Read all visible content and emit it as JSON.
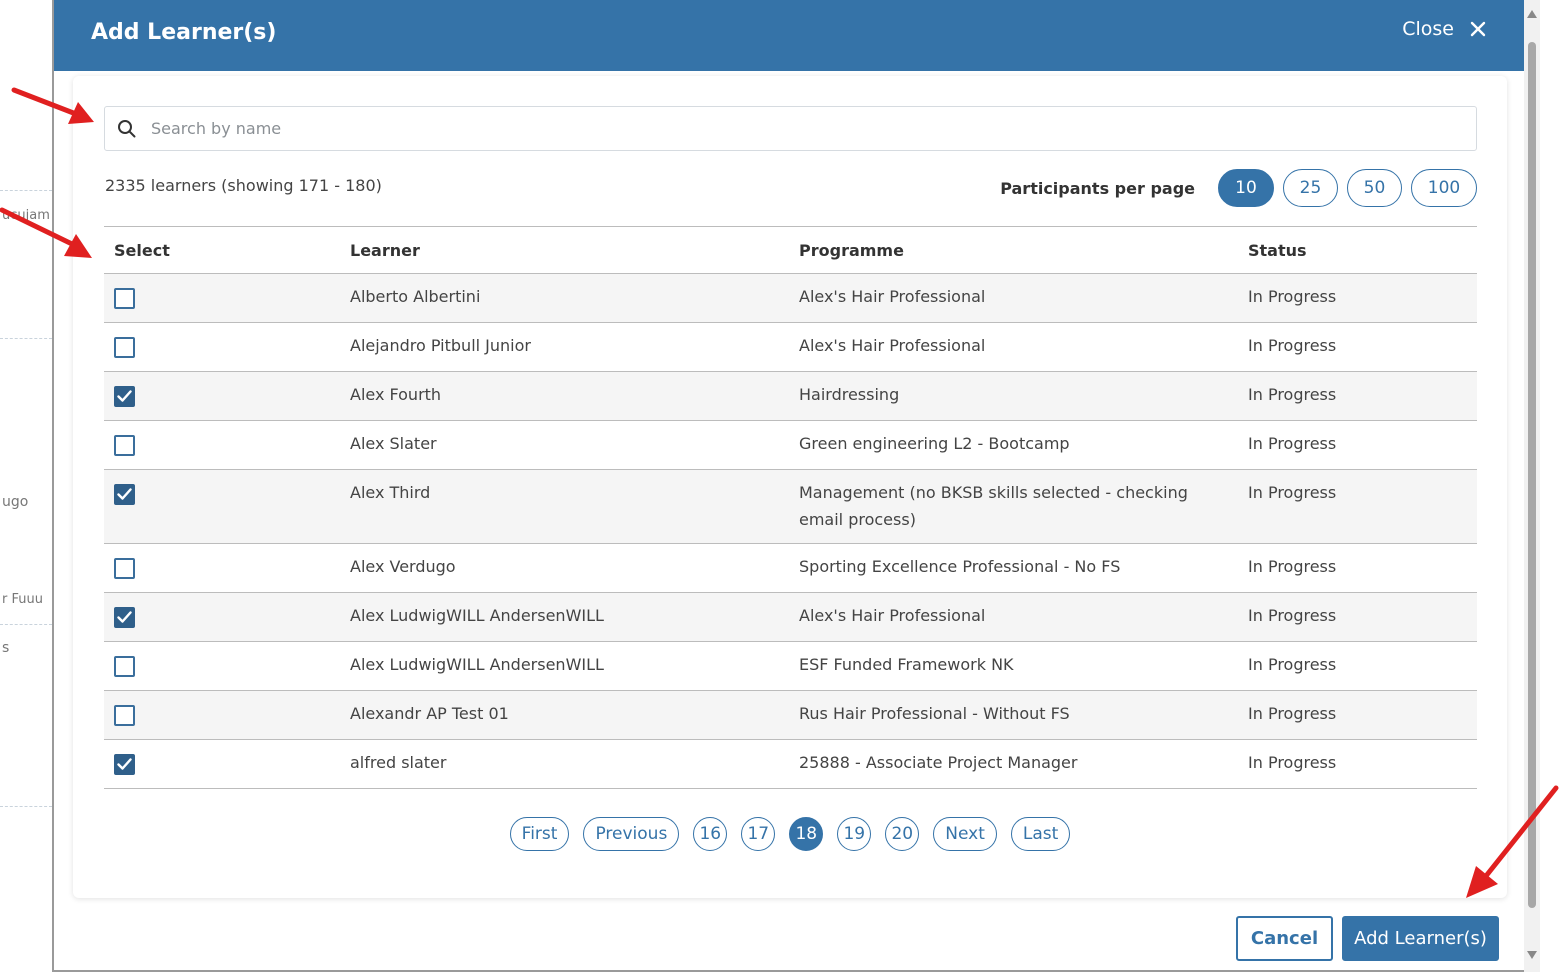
{
  "modal": {
    "title": "Add Learner(s)",
    "close_label": "Close"
  },
  "search": {
    "placeholder": "Search by name",
    "value": ""
  },
  "summary": {
    "count_text": "2335 learners (showing 171 - 180)"
  },
  "per_page": {
    "label": "Participants per page",
    "options": [
      "10",
      "25",
      "50",
      "100"
    ],
    "selected": "10"
  },
  "table": {
    "headers": {
      "select": "Select",
      "learner": "Learner",
      "programme": "Programme",
      "status": "Status"
    },
    "rows": [
      {
        "checked": false,
        "learner": "Alberto Albertini",
        "programme": "Alex's Hair Professional",
        "status": "In Progress"
      },
      {
        "checked": false,
        "learner": "Alejandro Pitbull Junior",
        "programme": "Alex's Hair Professional",
        "status": "In Progress"
      },
      {
        "checked": true,
        "learner": "Alex Fourth",
        "programme": "Hairdressing",
        "status": "In Progress"
      },
      {
        "checked": false,
        "learner": "Alex Slater",
        "programme": "Green engineering L2 - Bootcamp",
        "status": "In Progress"
      },
      {
        "checked": true,
        "learner": "Alex Third",
        "programme": "Management (no BKSB skills selected - checking email process)",
        "status": "In Progress"
      },
      {
        "checked": false,
        "learner": "Alex Verdugo",
        "programme": "Sporting Excellence Professional - No FS",
        "status": "In Progress"
      },
      {
        "checked": true,
        "learner": "Alex LudwigWILL AndersenWILL",
        "programme": "Alex's Hair Professional",
        "status": "In Progress"
      },
      {
        "checked": false,
        "learner": "Alex LudwigWILL AndersenWILL",
        "programme": "ESF Funded Framework NK",
        "status": "In Progress"
      },
      {
        "checked": false,
        "learner": "Alexandr AP Test 01",
        "programme": "Rus Hair Professional - Without FS",
        "status": "In Progress"
      },
      {
        "checked": true,
        "learner": "alfred slater",
        "programme": "25888 - Associate Project Manager",
        "status": "In Progress"
      }
    ]
  },
  "pagination": {
    "first": "First",
    "previous": "Previous",
    "pages": [
      "16",
      "17",
      "18",
      "19",
      "20"
    ],
    "current": "18",
    "next": "Next",
    "last": "Last"
  },
  "footer": {
    "cancel_label": "Cancel",
    "add_label": "Add Learner(s)"
  },
  "background_fragments": [
    "ucujam",
    "ugo",
    "r Fuuu",
    "s"
  ],
  "icons": {
    "search": "search-icon",
    "close": "close-icon",
    "checkbox_check": "check-icon"
  },
  "colors": {
    "primary": "#3573a8",
    "checkbox_checked": "#2f5f8a",
    "annotation_arrow": "#e02020",
    "row_stripe": "#f5f5f5"
  }
}
